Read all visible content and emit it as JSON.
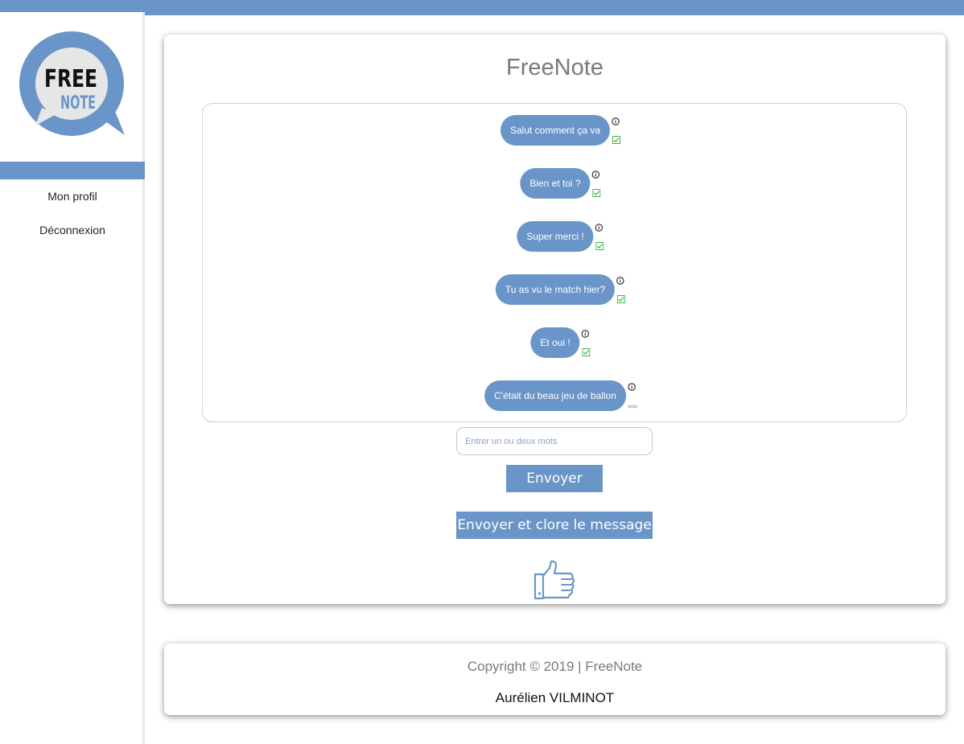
{
  "app": {
    "title": "FreeNote"
  },
  "logo": {
    "line1": "FREE",
    "line2": "NOTE"
  },
  "sidebar": {
    "items": [
      {
        "label": "Mon profil"
      },
      {
        "label": "Déconnexion"
      }
    ]
  },
  "chat": {
    "messages": [
      {
        "text": "Salut comment ça va",
        "status": "read"
      },
      {
        "text": "Bien et toi ?",
        "status": "read"
      },
      {
        "text": "Super merci !",
        "status": "read"
      },
      {
        "text": "Tu as vu le match hier?",
        "status": "read"
      },
      {
        "text": "Et oui !",
        "status": "read"
      },
      {
        "text": "C'était du beau jeu de ballon",
        "status": "pending"
      }
    ]
  },
  "composer": {
    "placeholder": "Entrer un ou deux mots",
    "value": "",
    "send_label": "Envoyer",
    "send_close_label": "Envoyer et clore le message"
  },
  "footer": {
    "copyright": "Copyright © 2019 | FreeNote",
    "author": "Aurélien VILMINOT"
  },
  "colors": {
    "accent": "#6a95c9",
    "check": "#3cb54a",
    "title_gray": "#7a7a7a"
  },
  "icons": {
    "info": "info-icon",
    "read": "check-icon",
    "pending": "pending-icon",
    "like": "thumbs-up-icon"
  }
}
